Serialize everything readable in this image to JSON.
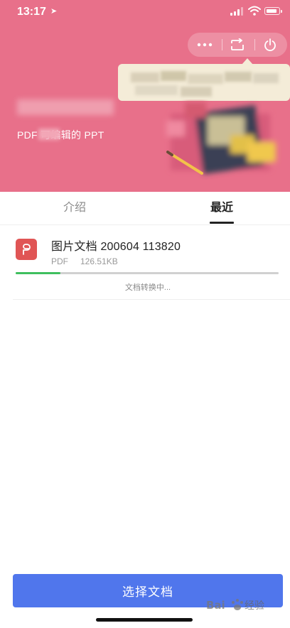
{
  "status_bar": {
    "time": "13:17",
    "location_glyph": "➤"
  },
  "header": {
    "subtitle": "PDF 可编辑的 PPT",
    "actions": [
      "more-icon",
      "share-icon",
      "power-icon"
    ]
  },
  "tabs": [
    {
      "label": "介绍",
      "selected": false
    },
    {
      "label": "最近",
      "selected": true
    }
  ],
  "recent_files": [
    {
      "title": "图片文档 200604 113820",
      "type": "PDF",
      "size": "126.51KB",
      "status": "文档转换中...",
      "progress": 0.17
    }
  ],
  "primary_action": "选择文档",
  "watermark": {
    "logo_text": "Bai",
    "text": "经验"
  },
  "colors": {
    "hero_bg": "#e8708a",
    "primary_button": "#5076ec",
    "progress": "#3fbf5e",
    "pdf_icon": "#e05555"
  }
}
